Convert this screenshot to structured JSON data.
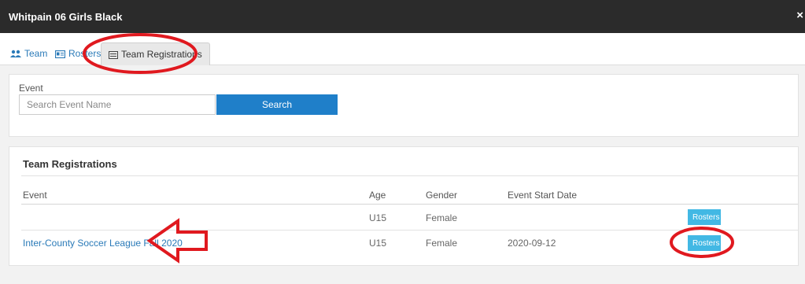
{
  "window": {
    "title": "Whitpain 06 Girls Black",
    "close_glyph": "×"
  },
  "tabs": [
    {
      "label": "Team",
      "icon": "users-icon",
      "active": false
    },
    {
      "label": "Rosters",
      "icon": "id-card-icon",
      "active": false
    },
    {
      "label": "Team Registrations",
      "icon": "list-icon",
      "active": true
    }
  ],
  "filter": {
    "event_label": "Event",
    "search_placeholder": "Search Event Name",
    "search_value": "",
    "search_button": "Search"
  },
  "registrations": {
    "title": "Team Registrations",
    "columns": [
      "Event",
      "Age",
      "Gender",
      "Event Start Date"
    ],
    "rows": [
      {
        "event": "",
        "age": "U15",
        "gender": "Female",
        "start_date": "",
        "action": "Rosters"
      },
      {
        "event": "Inter-County Soccer League Fall 2020",
        "age": "U15",
        "gender": "Female",
        "start_date": "2020-09-12",
        "action": "Rosters"
      }
    ]
  },
  "colors": {
    "title_bar": "#2b2b2b",
    "primary_button": "#1f7fc9",
    "rosters_button": "#42b8e4",
    "link": "#2a7ab8",
    "annotation": "#e0191f"
  }
}
